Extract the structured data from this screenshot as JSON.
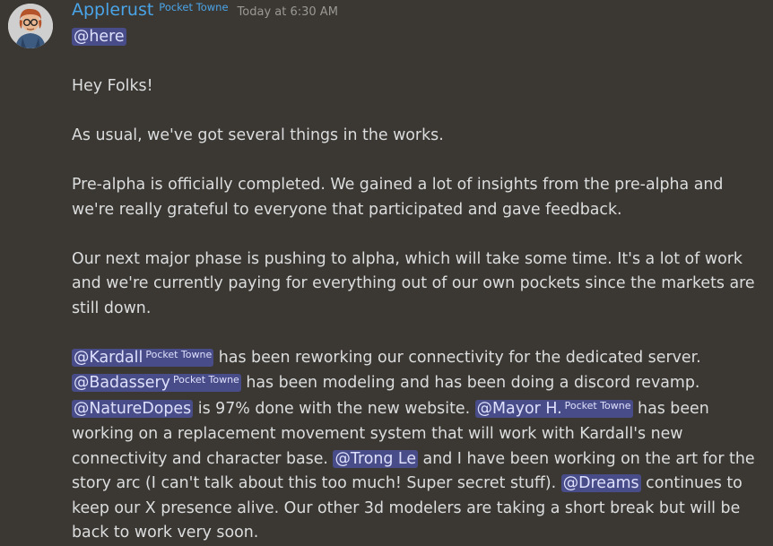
{
  "message": {
    "username": "Applerust",
    "role_tag": "Pocket Towne",
    "timestamp": "Today at 6:30 AM",
    "here_mention": "@here",
    "greeting": "Hey Folks!",
    "para1": "As usual, we've got several things in the works.",
    "para2_l1": "Pre-alpha is officially completed. We gained a lot of insights from the pre-alpha and",
    "para2_l2": "we're really grateful to everyone that participated and gave feedback.",
    "para3_l1": "Our next major phase is pushing to alpha, which will take some time. It's a lot of work",
    "para3_l2": "and we're currently paying for everything out of our own pockets since the markets are",
    "para3_l3": "still down.",
    "mentions": {
      "kardall": "@Kardall",
      "kardall_tag": "Pocket Towne",
      "badassery": "@Badassery",
      "badassery_tag": "Pocket Towne",
      "naturedopes": "@NatureDopes",
      "mayorh": "@Mayor H.",
      "mayorh_tag": "Pocket Towne",
      "trongle": "@Trong Le",
      "dreams": "@Dreams"
    },
    "para4": {
      "t1": " has been reworking our connectivity for the dedicated server.",
      "t2": " has been modeling and has been doing a discord revamp.",
      "t3": " is 97% done with the new website. ",
      "t4": " has been",
      "t5": "working on a replacement movement system that will work with Kardall's new",
      "t6": "connectivity and character base. ",
      "t7": " and I have been working on the art for the",
      "t8": "story arc (I can't talk about this too much! Super secret stuff). ",
      "t9": " continues to",
      "t10": "keep our X presence alive. Our other 3d modelers are taking a short break but will be",
      "t11": "back to work very soon."
    }
  },
  "colors": {
    "background": "#3b3833",
    "username": "#4aa4e8",
    "text": "#dcddde",
    "timestamp": "#9a9893",
    "mention_bg": "rgba(88,101,242,0.45)"
  }
}
